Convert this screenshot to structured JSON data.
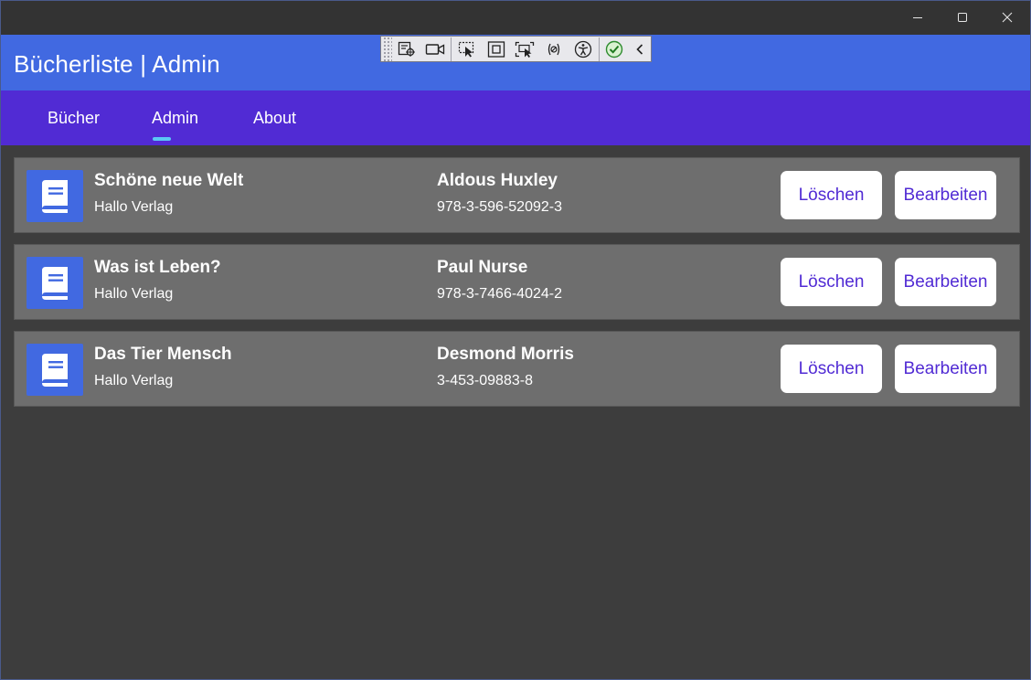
{
  "window": {
    "controls": [
      "minimize",
      "maximize",
      "close"
    ]
  },
  "header": {
    "title": "Bücherliste | Admin"
  },
  "devtools": {
    "tools": [
      "live-visual-tree-icon",
      "record-icon",
      "select-element-icon",
      "display-layout-adorners-icon",
      "track-focus-icon",
      "binding-failures-icon",
      "accessibility-checker-icon",
      "hot-reload-status-icon",
      "collapse-toolbar-icon"
    ]
  },
  "nav": {
    "tabs": [
      {
        "label": "Bücher",
        "selected": false
      },
      {
        "label": "Admin",
        "selected": true
      },
      {
        "label": "About",
        "selected": false
      }
    ]
  },
  "books": [
    {
      "title": "Schöne neue Welt",
      "publisher": "Hallo Verlag",
      "author": "Aldous Huxley",
      "isbn": "978-3-596-52092-3",
      "delete_label": "Löschen",
      "edit_label": "Bearbeiten"
    },
    {
      "title": "Was ist Leben?",
      "publisher": "Hallo Verlag",
      "author": "Paul Nurse",
      "isbn": "978-3-7466-4024-2",
      "delete_label": "Löschen",
      "edit_label": "Bearbeiten"
    },
    {
      "title": "Das Tier Mensch",
      "publisher": "Hallo Verlag",
      "author": "Desmond Morris",
      "isbn": "3-453-09883-8",
      "delete_label": "Löschen",
      "edit_label": "Bearbeiten"
    }
  ],
  "colors": {
    "header": "#4169e1",
    "navbar": "#512bd4",
    "tab_indicator": "#5bc8f5",
    "card": "#6e6e6e",
    "background": "#3d3d3d",
    "button_text": "#512bd4"
  }
}
